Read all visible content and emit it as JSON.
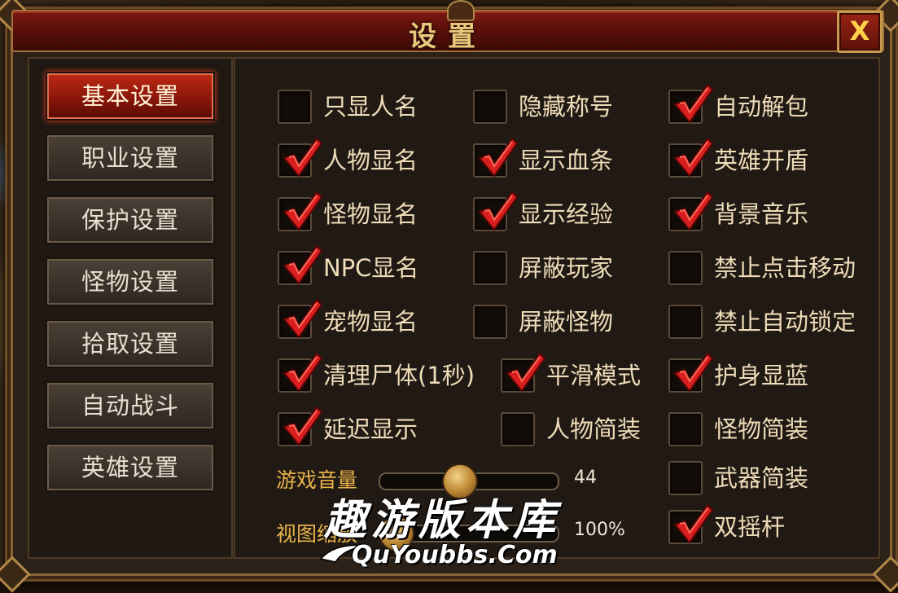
{
  "dialog": {
    "title": "设置",
    "close_label": "X"
  },
  "nav": {
    "items": [
      {
        "label": "基本设置",
        "active": true
      },
      {
        "label": "职业设置",
        "active": false
      },
      {
        "label": "保护设置",
        "active": false
      },
      {
        "label": "怪物设置",
        "active": false
      },
      {
        "label": "拾取设置",
        "active": false
      },
      {
        "label": "自动战斗",
        "active": false
      },
      {
        "label": "英雄设置",
        "active": false
      }
    ]
  },
  "options": [
    {
      "label": "只显人名",
      "checked": false
    },
    {
      "label": "隐藏称号",
      "checked": false
    },
    {
      "label": "自动解包",
      "checked": true
    },
    {
      "label": "人物显名",
      "checked": true
    },
    {
      "label": "显示血条",
      "checked": true
    },
    {
      "label": "英雄开盾",
      "checked": true
    },
    {
      "label": "怪物显名",
      "checked": true
    },
    {
      "label": "显示经验",
      "checked": true
    },
    {
      "label": "背景音乐",
      "checked": true
    },
    {
      "label": "NPC显名",
      "checked": true
    },
    {
      "label": "屏蔽玩家",
      "checked": false
    },
    {
      "label": "禁止点击移动",
      "checked": false
    },
    {
      "label": "宠物显名",
      "checked": true
    },
    {
      "label": "屏蔽怪物",
      "checked": false
    },
    {
      "label": "禁止自动锁定",
      "checked": false
    },
    {
      "label": "清理尸体(1秒)",
      "checked": true
    },
    {
      "label": "平滑模式",
      "checked": true
    },
    {
      "label": "护身显蓝",
      "checked": true
    },
    {
      "label": "延迟显示",
      "checked": true
    },
    {
      "label": "人物简装",
      "checked": false
    },
    {
      "label": "怪物简装",
      "checked": false
    },
    {
      "label": "武器简装",
      "checked": false
    },
    {
      "label": "双摇杆",
      "checked": true
    }
  ],
  "sliders": {
    "volume": {
      "label": "游戏音量",
      "value": "44",
      "level": 0.44
    },
    "zoom": {
      "label": "视图缩放",
      "value": "100%",
      "level": 0.0
    }
  },
  "watermark": {
    "text_cn": "趣游版本库",
    "text_en": "QuYoubbs.Com"
  },
  "colors": {
    "accent_red": "#b01e10",
    "gold": "#e8b44a",
    "check_red": "#d81e1e"
  }
}
